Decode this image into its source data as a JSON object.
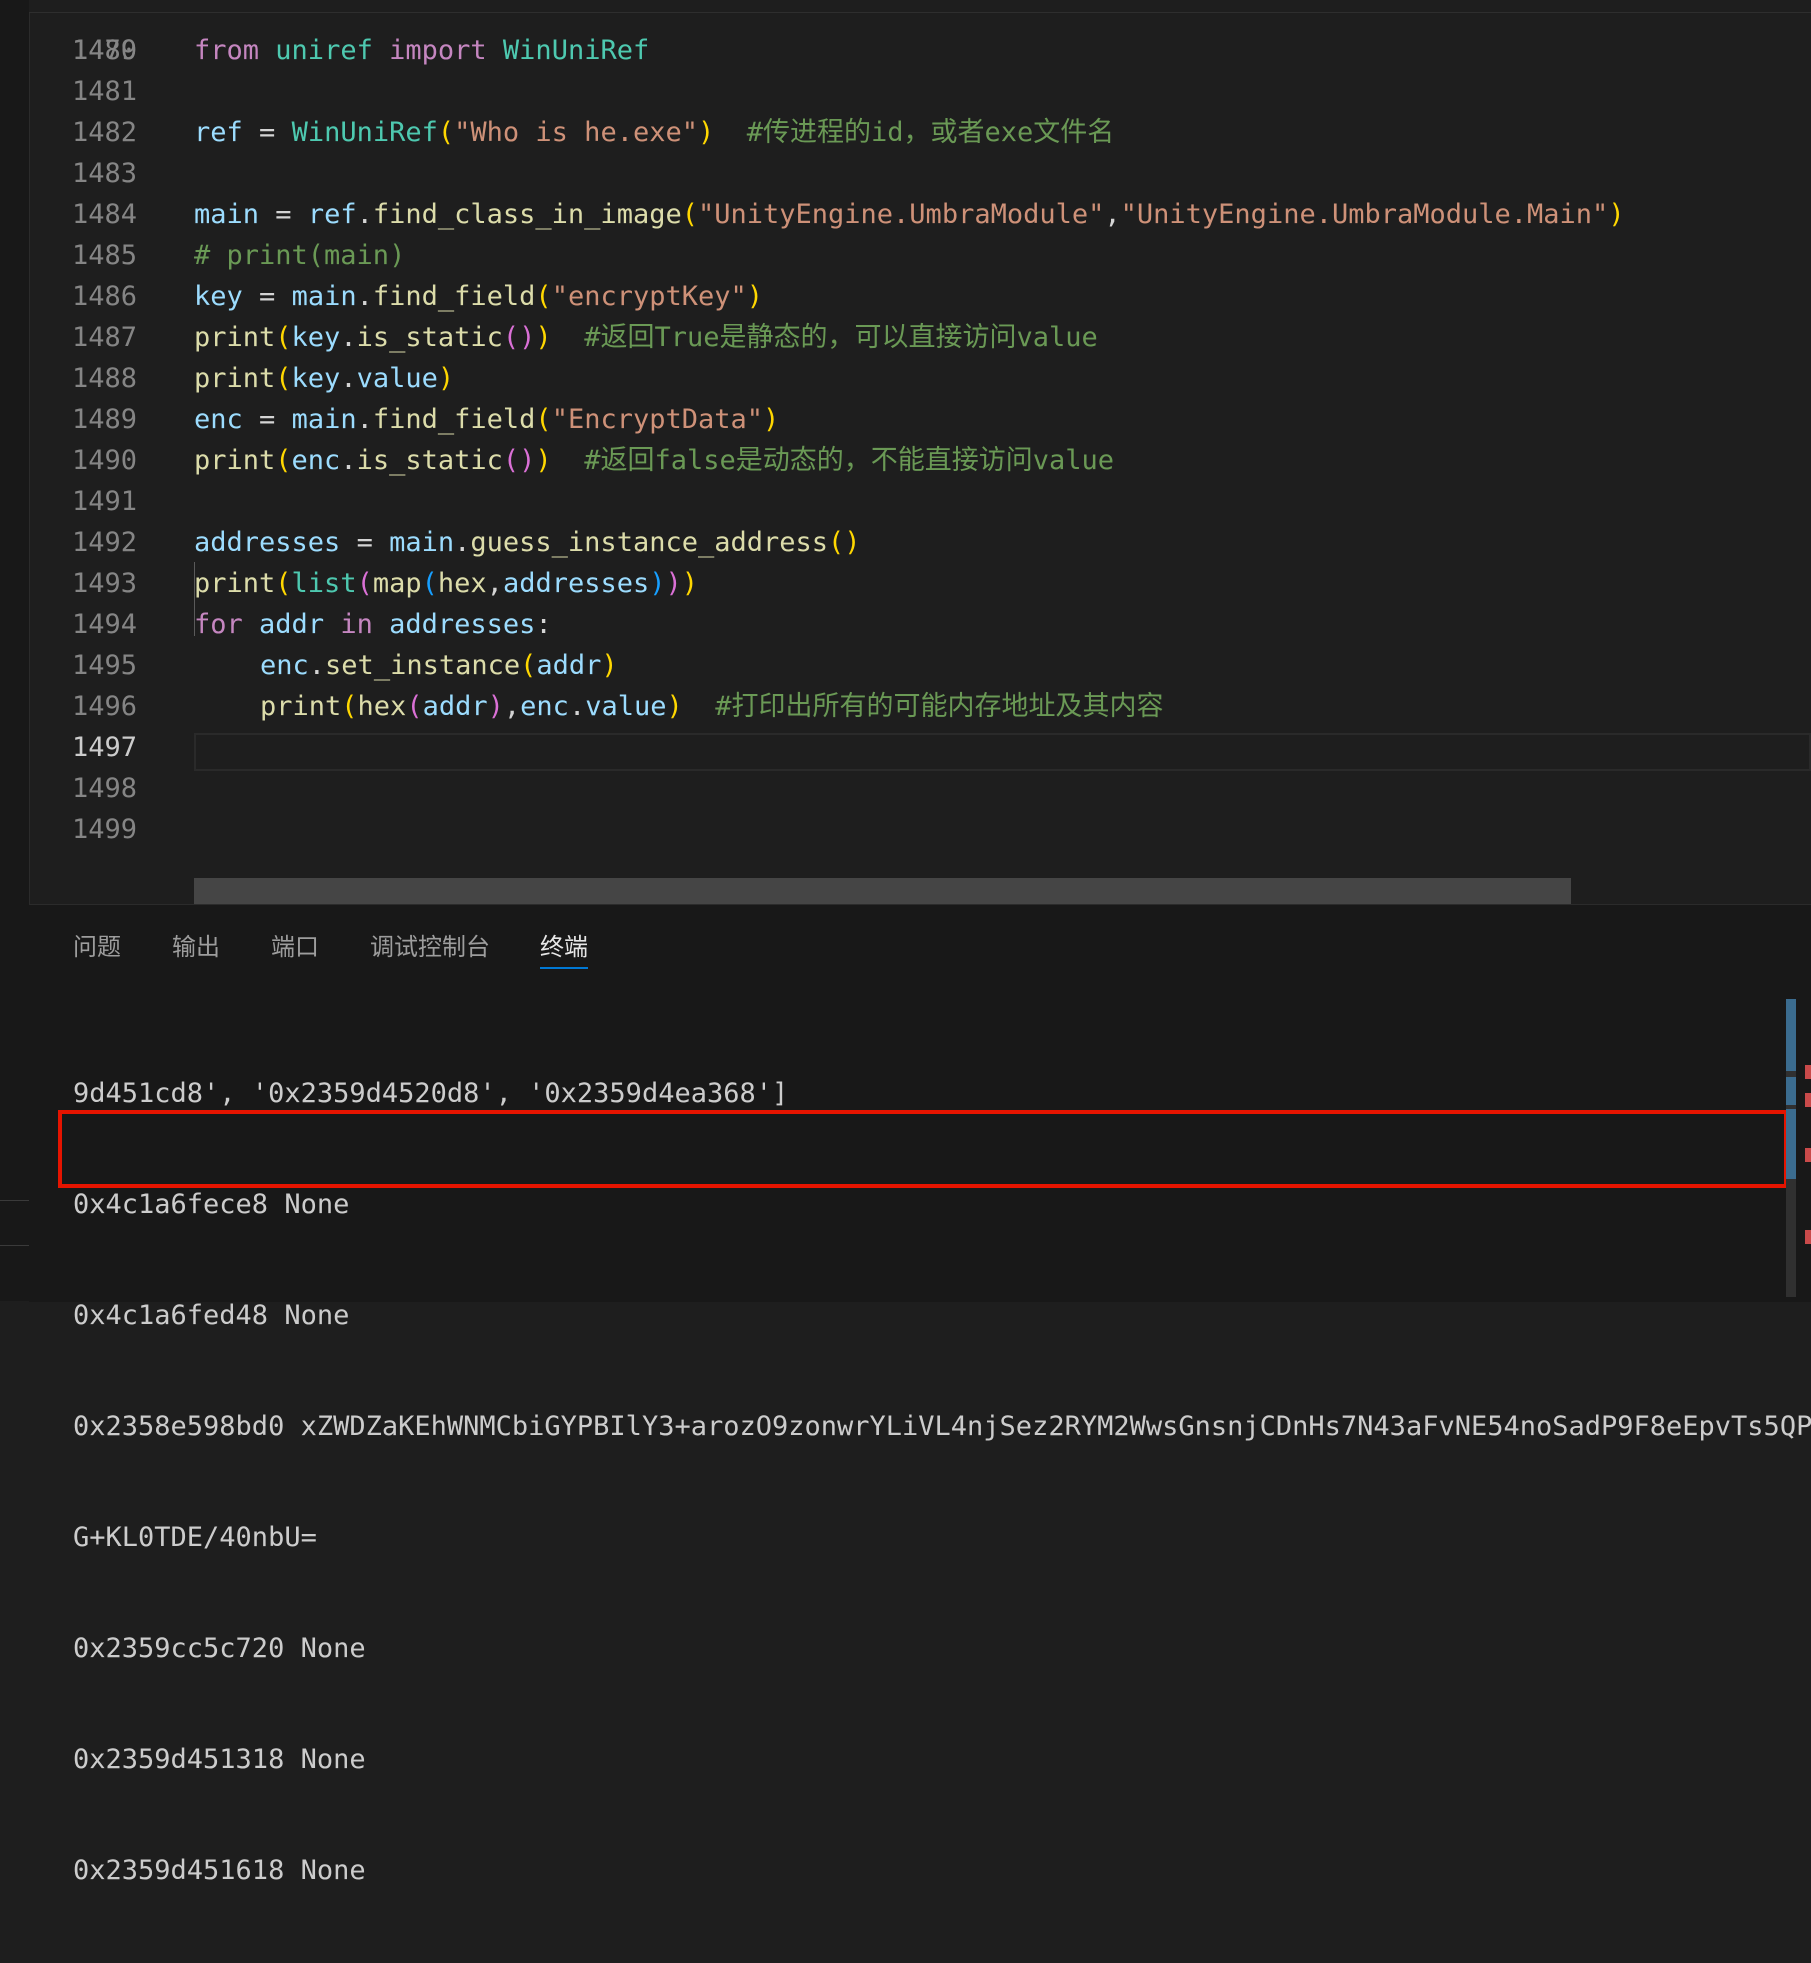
{
  "editor": {
    "partial_line_number": "1479",
    "active_line": "1497",
    "lines": [
      {
        "num": "1480",
        "segments": [
          [
            "kw",
            "from"
          ],
          [
            "op",
            " "
          ],
          [
            "mod",
            "uniref"
          ],
          [
            "op",
            " "
          ],
          [
            "kw",
            "import"
          ],
          [
            "op",
            " "
          ],
          [
            "mod",
            "WinUniRef"
          ]
        ]
      },
      {
        "num": "1481",
        "segments": []
      },
      {
        "num": "1482",
        "segments": [
          [
            "var",
            "ref"
          ],
          [
            "op",
            " = "
          ],
          [
            "mod",
            "WinUniRef"
          ],
          [
            "p1",
            "("
          ],
          [
            "str",
            "\"Who is he.exe\""
          ],
          [
            "p1",
            ")"
          ],
          [
            "op",
            "  "
          ],
          [
            "com",
            "#传进程的id，或者exe文件名"
          ]
        ]
      },
      {
        "num": "1483",
        "segments": []
      },
      {
        "num": "1484",
        "segments": [
          [
            "var",
            "main"
          ],
          [
            "op",
            " = "
          ],
          [
            "var",
            "ref"
          ],
          [
            "op",
            "."
          ],
          [
            "fn",
            "find_class_in_image"
          ],
          [
            "p1",
            "("
          ],
          [
            "str",
            "\"UnityEngine.UmbraModule\""
          ],
          [
            "op",
            ","
          ],
          [
            "str",
            "\"UnityEngine.UmbraModule.Main\""
          ],
          [
            "p1",
            ")"
          ]
        ]
      },
      {
        "num": "1485",
        "segments": [
          [
            "com",
            "# print(main)"
          ]
        ]
      },
      {
        "num": "1486",
        "segments": [
          [
            "var",
            "key"
          ],
          [
            "op",
            " = "
          ],
          [
            "var",
            "main"
          ],
          [
            "op",
            "."
          ],
          [
            "fn",
            "find_field"
          ],
          [
            "p1",
            "("
          ],
          [
            "str",
            "\"encryptKey\""
          ],
          [
            "p1",
            ")"
          ]
        ]
      },
      {
        "num": "1487",
        "segments": [
          [
            "fn",
            "print"
          ],
          [
            "p1",
            "("
          ],
          [
            "var",
            "key"
          ],
          [
            "op",
            "."
          ],
          [
            "fn",
            "is_static"
          ],
          [
            "p2",
            "()"
          ],
          [
            "p1",
            ")"
          ],
          [
            "op",
            "  "
          ],
          [
            "com",
            "#返回True是静态的，可以直接访问value"
          ]
        ]
      },
      {
        "num": "1488",
        "segments": [
          [
            "fn",
            "print"
          ],
          [
            "p1",
            "("
          ],
          [
            "var",
            "key"
          ],
          [
            "op",
            "."
          ],
          [
            "var",
            "value"
          ],
          [
            "p1",
            ")"
          ]
        ]
      },
      {
        "num": "1489",
        "segments": [
          [
            "var",
            "enc"
          ],
          [
            "op",
            " = "
          ],
          [
            "var",
            "main"
          ],
          [
            "op",
            "."
          ],
          [
            "fn",
            "find_field"
          ],
          [
            "p1",
            "("
          ],
          [
            "str",
            "\"EncryptData\""
          ],
          [
            "p1",
            ")"
          ]
        ]
      },
      {
        "num": "1490",
        "segments": [
          [
            "fn",
            "print"
          ],
          [
            "p1",
            "("
          ],
          [
            "var",
            "enc"
          ],
          [
            "op",
            "."
          ],
          [
            "fn",
            "is_static"
          ],
          [
            "p2",
            "()"
          ],
          [
            "p1",
            ")"
          ],
          [
            "op",
            "  "
          ],
          [
            "com",
            "#返回false是动态的，不能直接访问value"
          ]
        ]
      },
      {
        "num": "1491",
        "segments": []
      },
      {
        "num": "1492",
        "segments": [
          [
            "var",
            "addresses"
          ],
          [
            "op",
            " = "
          ],
          [
            "var",
            "main"
          ],
          [
            "op",
            "."
          ],
          [
            "fn",
            "guess_instance_address"
          ],
          [
            "p1",
            "()"
          ]
        ]
      },
      {
        "num": "1493",
        "segments": [
          [
            "fn",
            "print"
          ],
          [
            "p1",
            "("
          ],
          [
            "mod",
            "list"
          ],
          [
            "p2",
            "("
          ],
          [
            "fn",
            "map"
          ],
          [
            "p3",
            "("
          ],
          [
            "fn",
            "hex"
          ],
          [
            "op",
            ","
          ],
          [
            "var",
            "addresses"
          ],
          [
            "p3",
            ")"
          ],
          [
            "p2",
            ")"
          ],
          [
            "p1",
            ")"
          ]
        ]
      },
      {
        "num": "1494",
        "segments": [
          [
            "kw",
            "for"
          ],
          [
            "op",
            " "
          ],
          [
            "var",
            "addr"
          ],
          [
            "op",
            " "
          ],
          [
            "kw",
            "in"
          ],
          [
            "op",
            " "
          ],
          [
            "var",
            "addresses"
          ],
          [
            "op",
            ":"
          ]
        ]
      },
      {
        "num": "1495",
        "indent": true,
        "segments": [
          [
            "var",
            "enc"
          ],
          [
            "op",
            "."
          ],
          [
            "fn",
            "set_instance"
          ],
          [
            "p1",
            "("
          ],
          [
            "var",
            "addr"
          ],
          [
            "p1",
            ")"
          ]
        ]
      },
      {
        "num": "1496",
        "indent": true,
        "segments": [
          [
            "fn",
            "print"
          ],
          [
            "p1",
            "("
          ],
          [
            "fn",
            "hex"
          ],
          [
            "p2",
            "("
          ],
          [
            "var",
            "addr"
          ],
          [
            "p2",
            ")"
          ],
          [
            "op",
            ","
          ],
          [
            "var",
            "enc"
          ],
          [
            "op",
            "."
          ],
          [
            "var",
            "value"
          ],
          [
            "p1",
            ")"
          ],
          [
            "op",
            "  "
          ],
          [
            "com",
            "#打印出所有的可能内存地址及其内容"
          ]
        ]
      },
      {
        "num": "1497",
        "segments": []
      },
      {
        "num": "1498",
        "segments": []
      },
      {
        "num": "1499",
        "segments": []
      }
    ]
  },
  "panel": {
    "tabs": [
      "问题",
      "输出",
      "端口",
      "调试控制台",
      "终端"
    ],
    "active_tab": "终端",
    "terminal_lines": [
      "9d451cd8', '0x2359d4520d8', '0x2359d4ea368']",
      "0x4c1a6fece8 None",
      "0x4c1a6fed48 None",
      "0x2358e598bd0 xZWDZaKEhWNMCbiGYPBIlY3+arozO9zonwrYLiVL4njSez2RYM2WwsGnsnjCDnHs7N43aFvNE54noSadP9F8eEpvTs5QP",
      "G+KL0TDE/40nbU=",
      "0x2359cc5c720 None",
      "0x2359d451318 None",
      "0x2359d451618 None"
    ]
  },
  "colors": {
    "highlight_box": "#e51400",
    "active_tab_underline": "#0078d4"
  }
}
